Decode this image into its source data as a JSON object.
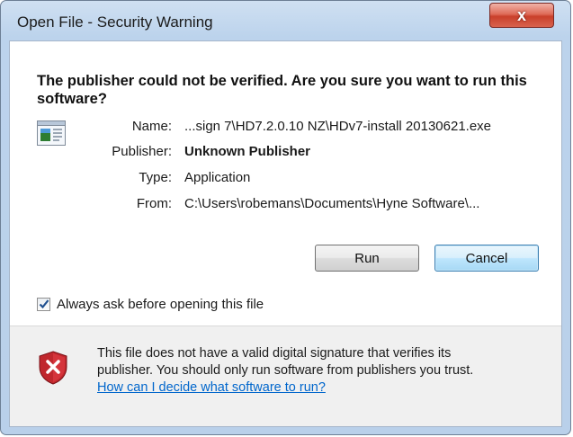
{
  "window": {
    "title": "Open File - Security Warning",
    "close_label": "x"
  },
  "headline": "The publisher could not be verified.  Are you sure you want to run this software?",
  "details": {
    "name_label": "Name:",
    "name_value": "...sign 7\\HD7.2.0.10 NZ\\HDv7-install 20130621.exe",
    "publisher_label": "Publisher:",
    "publisher_value": "Unknown Publisher",
    "type_label": "Type:",
    "type_value": "Application",
    "from_label": "From:",
    "from_value": "C:\\Users\\robemans\\Documents\\Hyne Software\\..."
  },
  "buttons": {
    "run": "Run",
    "cancel": "Cancel"
  },
  "checkbox": {
    "label": "Always ask before opening this file",
    "checked": true
  },
  "warning": {
    "line1": "This file does not have a valid digital signature that verifies its",
    "line2": "publisher.  You should only run software from publishers you trust.",
    "link": "How can I decide what software to run?"
  },
  "icons": {
    "file": "application-file-icon",
    "shield": "security-shield-error-icon",
    "check": "checkmark-icon"
  },
  "colors": {
    "close_red": "#c9402b",
    "link_blue": "#0066cc",
    "shield_red": "#c0272d",
    "cancel_focus": "#3c7fb1"
  }
}
